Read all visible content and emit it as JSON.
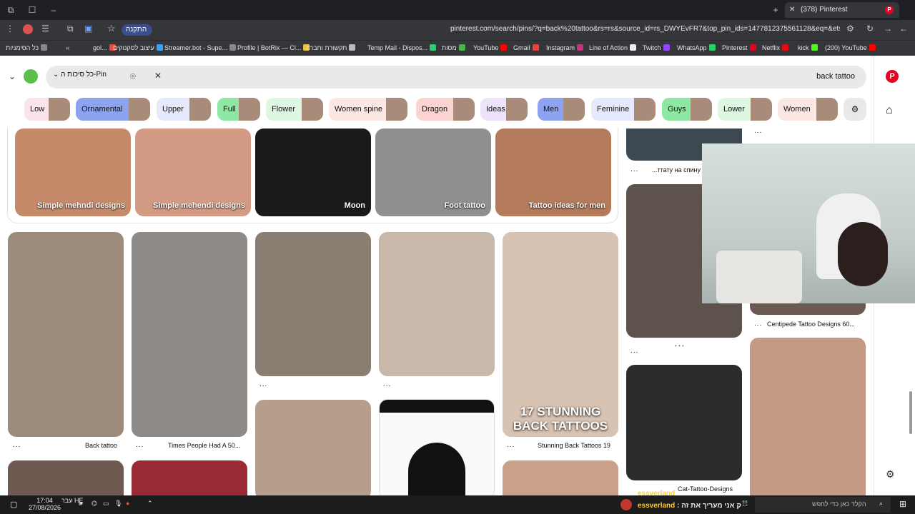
{
  "browser": {
    "tab_title": "(378) Pinterest",
    "url": "pinterest.com/search/pins/?q=back%20tattoo&rs=rs&source_id=rs_DWYEvFR7&top_pin_ids=1477812375561128&eq=&etslf=2263",
    "restore_label": "התקנה",
    "bookmarks": [
      "כל הסימניות",
      "gol...",
      "עיצוב לסקנוקים",
      "Streamer.bot - Supe...",
      "Profile | BotRix — Cl...",
      "תקשורת וחברה",
      "Temp Mail - Dispos...",
      "מסות",
      "YouTube",
      "Gmail",
      "Instagram",
      "Line of Action",
      "Twitch",
      "WhatsApp",
      "Pinterest",
      "Netflix",
      "kick",
      "(200) YouTube"
    ]
  },
  "search": {
    "query": "back tattoo",
    "boards_label": "כל סיכות ה-Pin"
  },
  "chips": [
    {
      "label": "Low",
      "bg": "#fbe3ee"
    },
    {
      "label": "Ornamental",
      "bg": "#8ea3f0"
    },
    {
      "label": "Upper",
      "bg": "#e6e9fb"
    },
    {
      "label": "Full",
      "bg": "#8ee8a3"
    },
    {
      "label": "Flower",
      "bg": "#def6e2"
    },
    {
      "label": "Women spine",
      "bg": "#fbe8e3"
    },
    {
      "label": "Dragon",
      "bg": "#fbd3d1"
    },
    {
      "label": "Ideas",
      "bg": "#ede3fb"
    },
    {
      "label": "Men",
      "bg": "#8ea3f0"
    },
    {
      "label": "Feminine",
      "bg": "#e6e9fb"
    },
    {
      "label": "Guys",
      "bg": "#8ee8a3"
    },
    {
      "label": "Lower",
      "bg": "#def6e2"
    },
    {
      "label": "Women",
      "bg": "#fbe8e3"
    }
  ],
  "related_row": [
    {
      "label": "Simple mehndi designs",
      "color": "#c48a6a"
    },
    {
      "label": "Simple mehendi designs",
      "color": "#d39a84"
    },
    {
      "label": "Moon",
      "color": "#1a1a1a"
    },
    {
      "label": "Foot tattoo",
      "color": "#8f8f8f"
    },
    {
      "label": "Tattoo ideas for men",
      "color": "#b37a5c"
    }
  ],
  "pins": [
    {
      "title": "Back tattoo",
      "color": "#9c8a7a"
    },
    {
      "title": "Times People Had A 50...",
      "color": "#8e8a88"
    },
    {
      "title": "",
      "color": "#8a7e72"
    },
    {
      "title": "",
      "color": "#c8b8aa"
    },
    {
      "title": "Stunning Back Tattoos 19",
      "color": "#d8c2b2"
    },
    {
      "title": "17 STUNNING BACK TATTOOS",
      "color": "#d8c2b2"
    },
    {
      "title": "...ттату на спину",
      "color": "#3c4852"
    },
    {
      "title": "Centipede Tattoo Designs 60...",
      "color": "#6b5a52"
    },
    {
      "title": "Cat-Tattoo-Designs",
      "color": "#2b2b2b"
    },
    {
      "title": "",
      "color": "#c49a85"
    }
  ],
  "more_label": "...",
  "taskbar": {
    "time": "17:04",
    "date": "27/08/2026",
    "lang": "עבר HE",
    "search_placeholder": "הקלד כאן כדי לחפש",
    "chat_user": "essverland",
    "chat_msg": "ק אני מעריך את זה"
  }
}
